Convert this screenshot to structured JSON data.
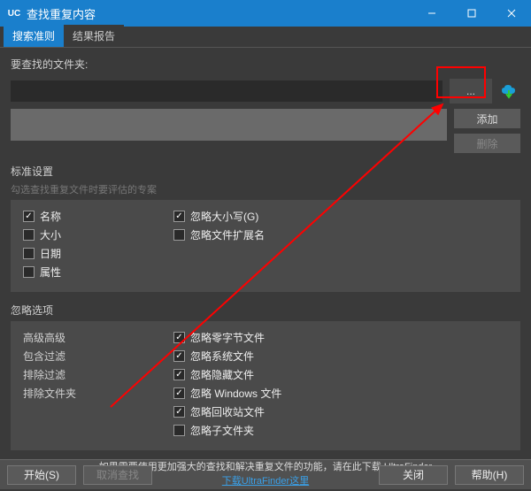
{
  "window": {
    "logo": "UC",
    "title": "查找重复内容"
  },
  "tabs": {
    "search_criteria": "搜索准则",
    "results_report": "结果报告"
  },
  "folder": {
    "label": "要查找的文件夹:",
    "browse": "...",
    "add": "添加",
    "delete": "删除"
  },
  "criteria": {
    "title": "标准设置",
    "subtitle": "勾选查找重复文件时要评估的专案",
    "name": "名称",
    "size": "大小",
    "date": "日期",
    "attrs": "属性",
    "ignore_case": "忽略大小写(G)",
    "ignore_ext": "忽略文件扩展名"
  },
  "ignore": {
    "title": "忽略选项",
    "adv": "高级高级",
    "incl_filter": "包含过滤",
    "excl_filter": "排除过滤",
    "excl_folder": "排除文件夹",
    "zero": "忽略零字节文件",
    "system": "忽略系统文件",
    "hidden": "忽略隐藏文件",
    "windows": "忽略 Windows 文件",
    "recycle": "忽略回收站文件",
    "subfolders": "忽略子文件夹"
  },
  "promo": {
    "text": "如果需要使用更加强大的查找和解决重复文件的功能，请在此下载 UltraFinder",
    "link": "下载UltraFinder这里"
  },
  "footer": {
    "start": "开始(S)",
    "cancel": "取消查找",
    "close": "关闭",
    "help": "帮助(H)"
  }
}
